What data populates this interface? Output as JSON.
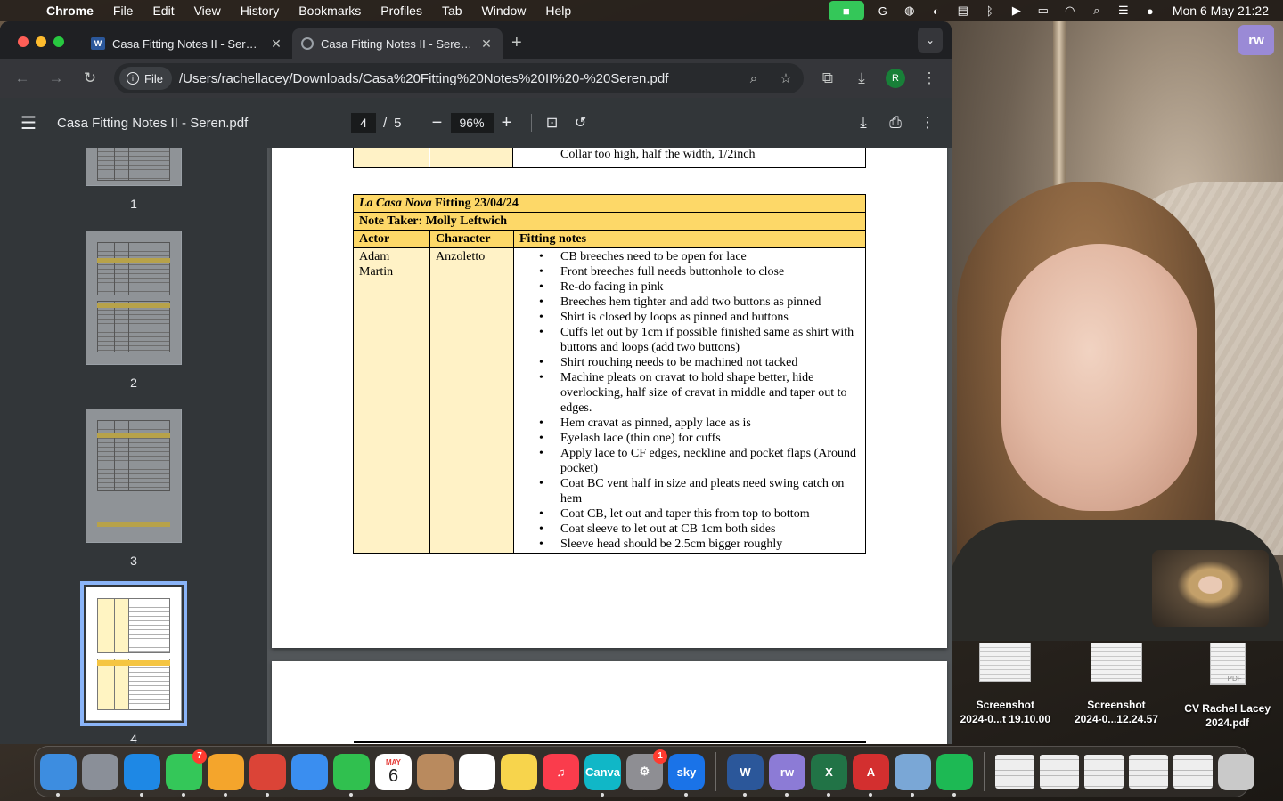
{
  "menubar": {
    "app": "Chrome",
    "items": [
      "File",
      "Edit",
      "View",
      "History",
      "Bookmarks",
      "Profiles",
      "Tab",
      "Window",
      "Help"
    ],
    "clock": "Mon 6 May  21:22"
  },
  "browser": {
    "tabs": [
      {
        "title": "Casa Fitting Notes II - Seren.docx",
        "favicon": "word-icon"
      },
      {
        "title": "Casa Fitting Notes II - Seren.pdf",
        "favicon": "globe-icon"
      }
    ],
    "address": {
      "chip": "File",
      "url": "/Users/rachellacey/Downloads/Casa%20Fitting%20Notes%20II%20-%20Seren.pdf"
    },
    "profile_initial": "R"
  },
  "pdf": {
    "title": "Casa Fitting Notes II - Seren.pdf",
    "current_page": "4",
    "page_sep": "/",
    "total_pages": "5",
    "zoom": "96%",
    "thumbnails": [
      "1",
      "2",
      "3",
      "4"
    ],
    "prev_table_cut_text": "Collar too high, half the width, 1/2inch",
    "table": {
      "title_italic": "La Casa Nova",
      "title_rest": " Fitting 23/04/24",
      "note_taker": "Note Taker: Molly Leftwich",
      "headers": [
        "Actor",
        "Character",
        "Fitting notes"
      ],
      "actor": "Adam Martin",
      "character": "Anzoletto",
      "notes": [
        "CB breeches need to be open for lace",
        "Front breeches full needs buttonhole to close",
        "Re-do facing in pink",
        "Breeches hem tighter and add two buttons as pinned",
        "Shirt is closed by loops as pinned and buttons",
        "Cuffs let out by 1cm if possible finished same as shirt with buttons and loops (add two buttons)",
        "Shirt rouching needs to be machined not tacked",
        "Machine pleats on cravat to hold shape better, hide overlocking, half size of cravat in middle and taper out to edges.",
        "Hem cravat as pinned, apply lace as is",
        "Eyelash lace (thin one) for cuffs",
        "Apply lace to CF edges, neckline and pocket flaps (Around pocket)",
        "Coat BC vent half in size and pleats need swing catch on hem",
        "Coat CB, let out and taper this from top to bottom",
        "Coat sleeve to let out at CB 1cm both sides",
        "Sleeve head should be 2.5cm bigger roughly"
      ]
    }
  },
  "video": {
    "badge": "rw"
  },
  "desktop_files": [
    {
      "line1": "Screenshot",
      "line2": "2024-0...t 19.10.00",
      "kind": "screenshot"
    },
    {
      "line1": "Screenshot",
      "line2": "2024-0...12.24.57",
      "kind": "screenshot"
    },
    {
      "line1": "CV Rachel Lacey",
      "line2": "2024.pdf",
      "kind": "pdf",
      "tag": "PDF"
    }
  ],
  "dock": {
    "apps": [
      {
        "name": "Finder",
        "color": "#3d8de0",
        "label": "",
        "running": true
      },
      {
        "name": "Launchpad",
        "color": "#8a8f98",
        "label": "",
        "running": false
      },
      {
        "name": "Safari",
        "color": "#1e88e5",
        "label": "",
        "running": true
      },
      {
        "name": "Messages",
        "color": "#34c759",
        "label": "",
        "running": true,
        "badge": "7"
      },
      {
        "name": "Photos",
        "color": "#f4a52c",
        "label": "",
        "running": true
      },
      {
        "name": "Chrome",
        "color": "#db4437",
        "label": "",
        "running": true
      },
      {
        "name": "Mail",
        "color": "#3a8ef0",
        "label": "",
        "running": false
      },
      {
        "name": "FaceTime",
        "color": "#30c04f",
        "label": "",
        "running": true
      },
      {
        "name": "Calendar",
        "color": "#ffffff",
        "label": "6",
        "running": false,
        "text_color": "#222",
        "sub": "MAY"
      },
      {
        "name": "Contacts",
        "color": "#b98a5e",
        "label": "",
        "running": false
      },
      {
        "name": "Reminders",
        "color": "#ffffff",
        "label": "",
        "running": false
      },
      {
        "name": "Notes",
        "color": "#f7d44c",
        "label": "",
        "running": false
      },
      {
        "name": "Music",
        "color": "#fa3c4c",
        "label": "♫",
        "running": false
      },
      {
        "name": "Canva",
        "color": "#10b7c7",
        "label": "Canva",
        "running": true
      },
      {
        "name": "System Settings",
        "color": "#8e8e93",
        "label": "⚙",
        "running": false,
        "badge": "1"
      },
      {
        "name": "Sky Go",
        "color": "#1a73e8",
        "label": "sky",
        "running": true
      }
    ],
    "apps2": [
      {
        "name": "Word",
        "color": "#2b579a",
        "label": "W",
        "running": true
      },
      {
        "name": "Rewind",
        "color": "#8c7bd6",
        "label": "rw",
        "running": true
      },
      {
        "name": "Excel",
        "color": "#217346",
        "label": "X",
        "running": true
      },
      {
        "name": "Acrobat",
        "color": "#d32f2f",
        "label": "A",
        "running": true
      },
      {
        "name": "Preview",
        "color": "#7aa7d6",
        "label": "",
        "running": true
      },
      {
        "name": "Spotify",
        "color": "#1db954",
        "label": "",
        "running": true
      }
    ]
  }
}
